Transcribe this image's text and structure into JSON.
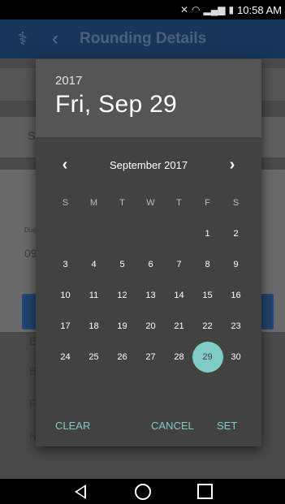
{
  "status_bar": {
    "time": "10:58 AM",
    "icons": [
      "mute-icon",
      "wifi-icon",
      "signal-icon",
      "battery-icon"
    ]
  },
  "app_bar": {
    "title": "Rounding Details"
  },
  "background_texts": {
    "s1": "S",
    "d1": "Disc",
    "d2": "09",
    "e": "E",
    "b": "B",
    "f": "F",
    "n": "N"
  },
  "dialog": {
    "year": "2017",
    "selected_date": "Fri, Sep 29",
    "month_label": "September 2017",
    "prev_arrow": "‹",
    "next_arrow": "›",
    "weekdays": [
      "S",
      "M",
      "T",
      "W",
      "T",
      "F",
      "S"
    ],
    "weeks": [
      [
        "",
        "",
        "",
        "",
        "",
        "1",
        "2"
      ],
      [
        "3",
        "4",
        "5",
        "6",
        "7",
        "8",
        "9"
      ],
      [
        "10",
        "11",
        "12",
        "13",
        "14",
        "15",
        "16"
      ],
      [
        "17",
        "18",
        "19",
        "20",
        "21",
        "22",
        "23"
      ],
      [
        "24",
        "25",
        "26",
        "27",
        "28",
        "29",
        "30"
      ]
    ],
    "selected_day": "29",
    "clear_label": "CLEAR",
    "cancel_label": "CANCEL",
    "set_label": "SET",
    "accent_color": "#80cbc4"
  }
}
